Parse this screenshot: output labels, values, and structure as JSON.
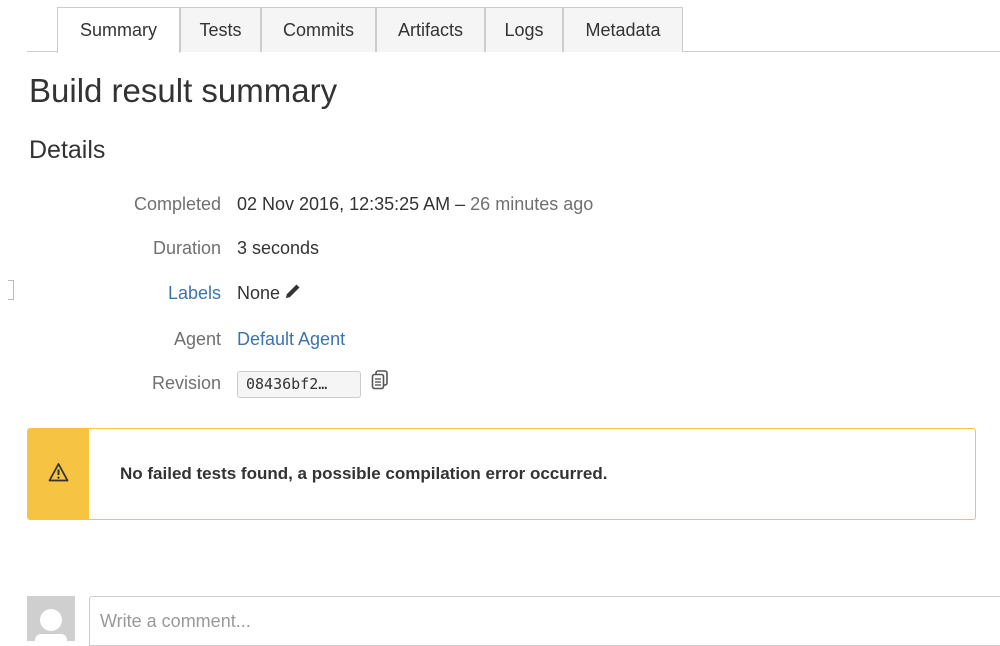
{
  "tabs": [
    {
      "label": "Summary",
      "active": true
    },
    {
      "label": "Tests",
      "active": false
    },
    {
      "label": "Commits",
      "active": false
    },
    {
      "label": "Artifacts",
      "active": false
    },
    {
      "label": "Logs",
      "active": false
    },
    {
      "label": "Metadata",
      "active": false
    }
  ],
  "page": {
    "title": "Build result summary",
    "details_heading": "Details"
  },
  "details": {
    "completed": {
      "label": "Completed",
      "datetime": "02 Nov 2016, 12:35:25 AM",
      "separator": " – ",
      "relative": "26 minutes ago"
    },
    "duration": {
      "label": "Duration",
      "value": "3 seconds"
    },
    "labels": {
      "label": "Labels",
      "value": "None",
      "edit_icon": "pencil-icon"
    },
    "agent": {
      "label": "Agent",
      "value": "Default Agent"
    },
    "revision": {
      "label": "Revision",
      "value": "08436bf2…",
      "copy_icon": "copy-icon"
    }
  },
  "warning": {
    "icon": "warning-icon",
    "message": "No failed tests found, a possible compilation error occurred."
  },
  "comment": {
    "placeholder": "Write a comment..."
  },
  "colors": {
    "link": "#3b73af",
    "warning": "#f6c342",
    "border": "#cccccc",
    "muted": "#707070"
  }
}
